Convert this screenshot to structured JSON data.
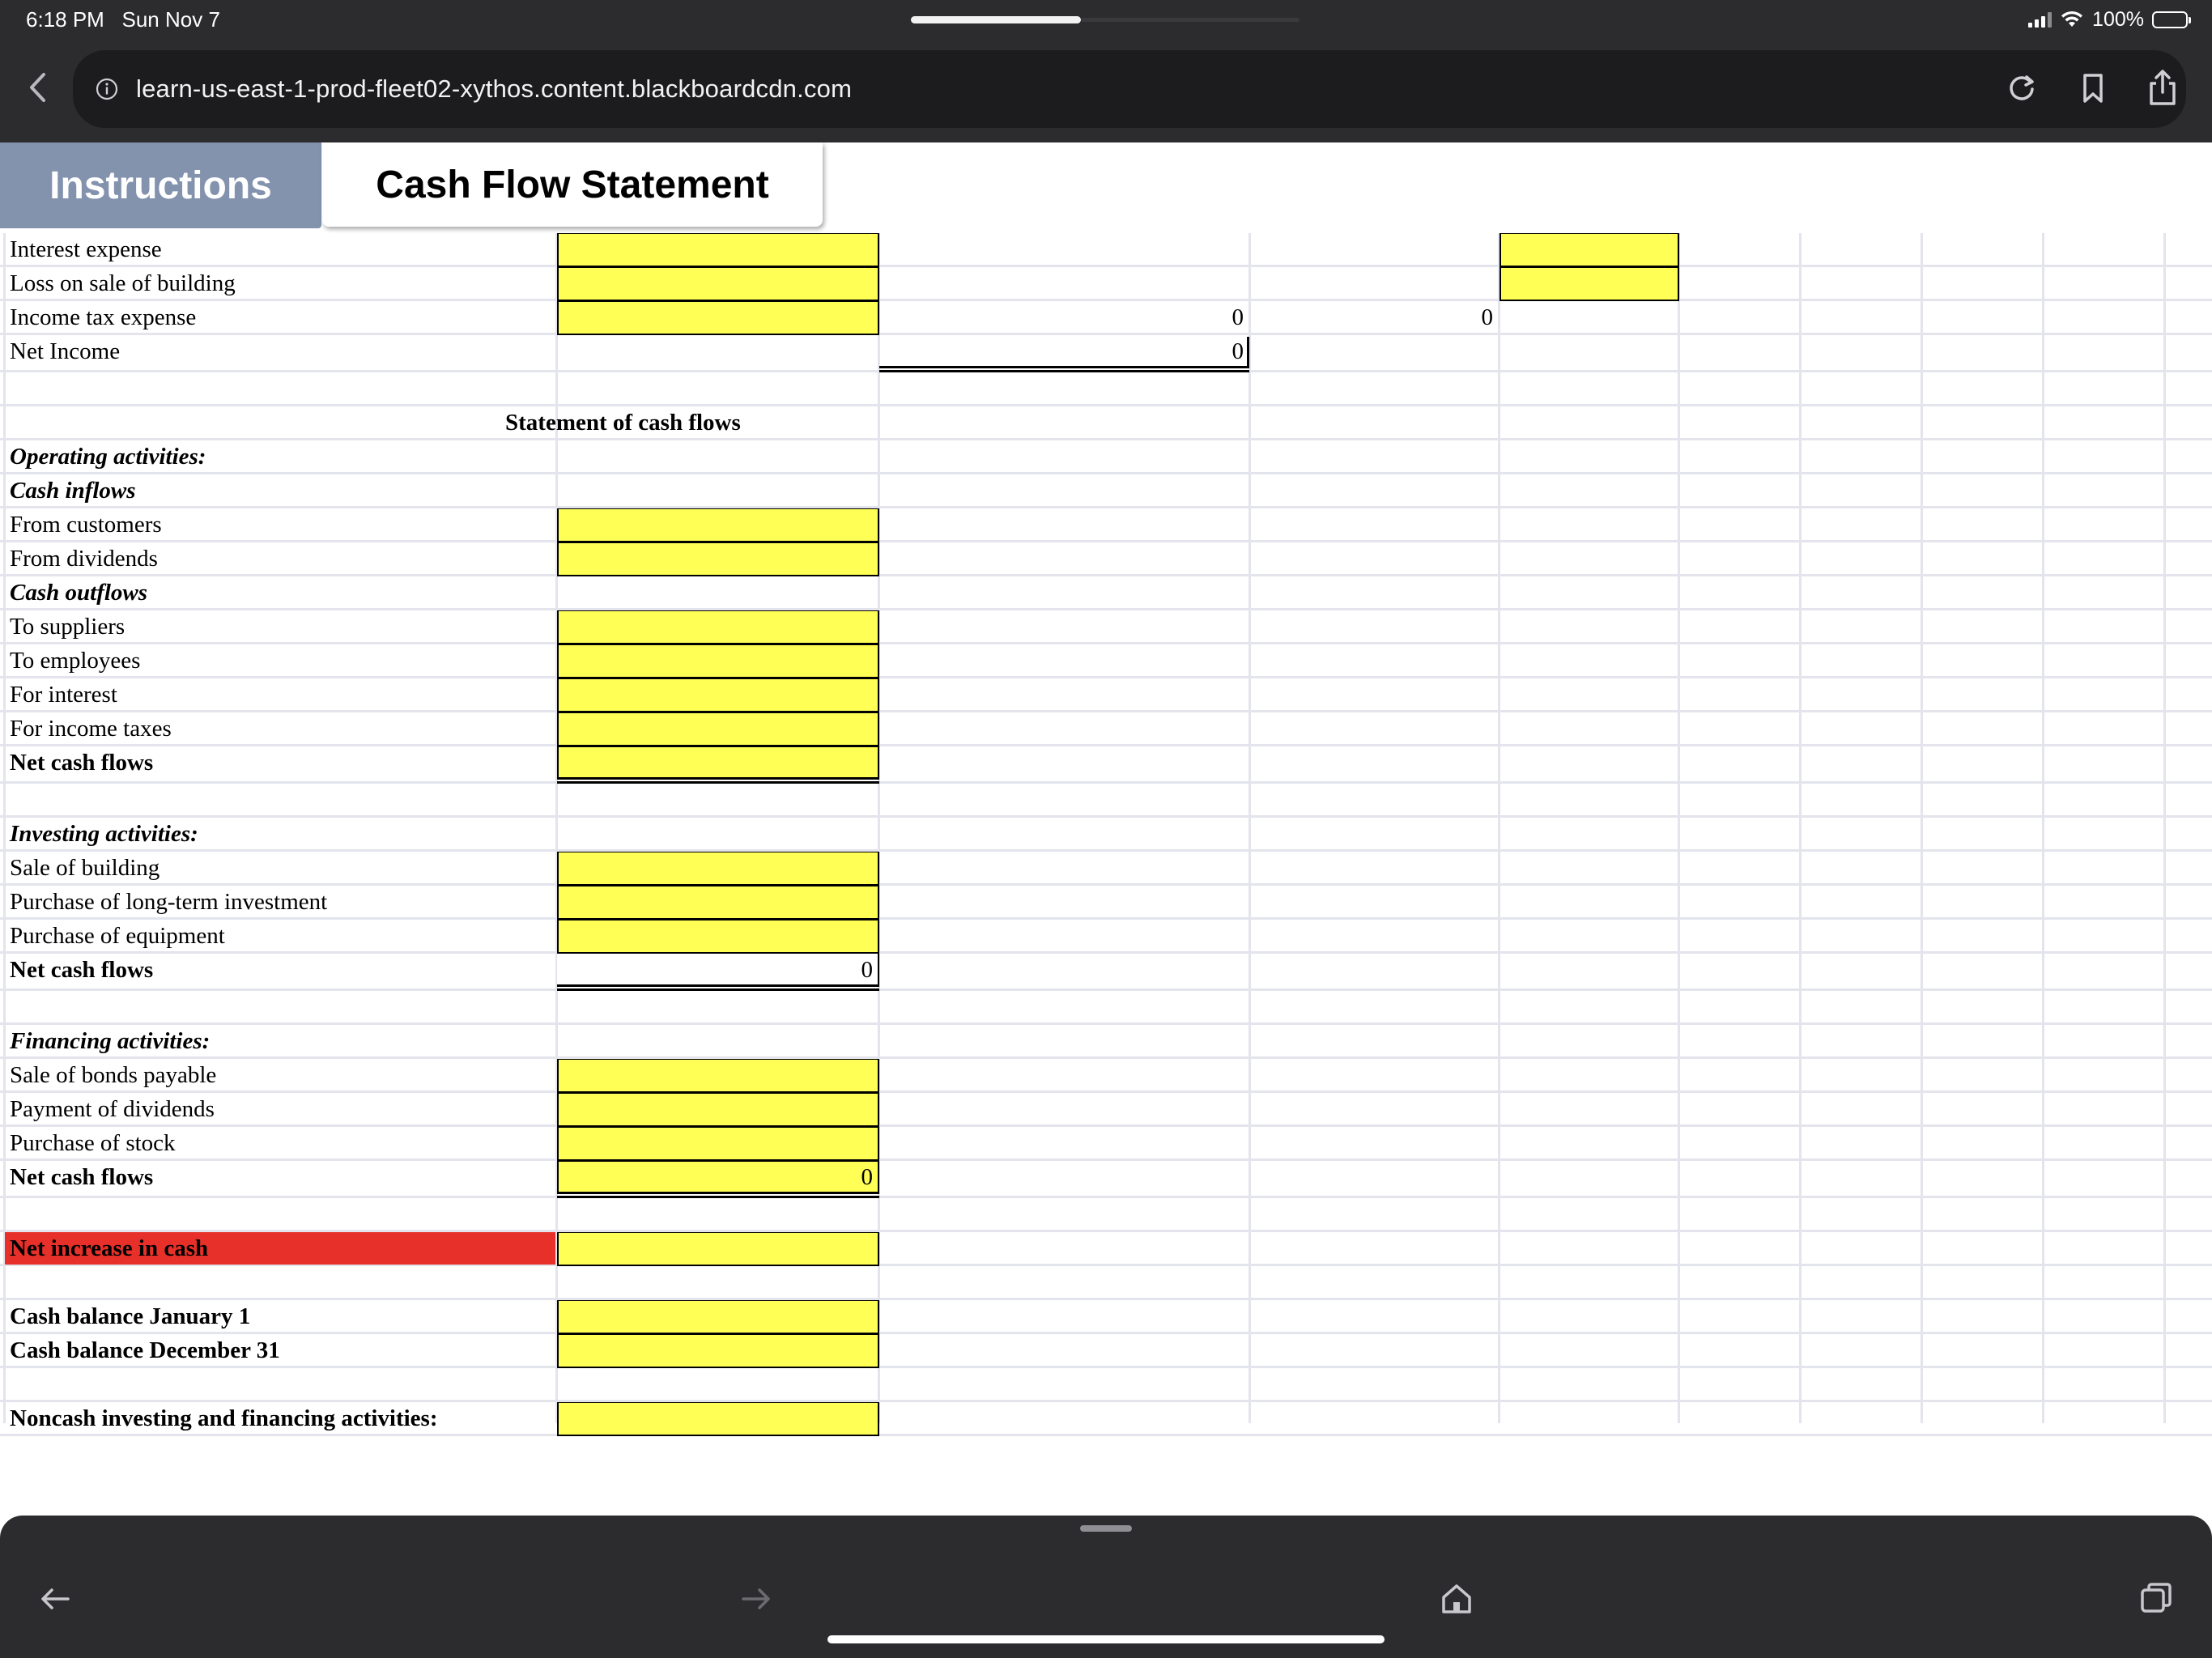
{
  "status_bar": {
    "time": "6:18 PM",
    "date": "Sun Nov 7",
    "battery": "100%"
  },
  "browser": {
    "url": "learn-us-east-1-prod-fleet02-xythos.content.blackboardcdn.com"
  },
  "tabs": [
    {
      "label": "Instructions",
      "active": false
    },
    {
      "label": "Cash Flow Statement",
      "active": true
    }
  ],
  "income_rows": [
    {
      "label": "Interest expense"
    },
    {
      "label": "Loss on sale of building"
    },
    {
      "label": "Income tax expense",
      "col_d": "0",
      "col_e": "0"
    },
    {
      "label": "Net Income",
      "col_d": "0"
    }
  ],
  "statement_title": "Statement of cash flows",
  "operating": {
    "heading": "Operating activities:",
    "inflows_heading": "Cash inflows",
    "inflows": [
      "From customers",
      "From dividends"
    ],
    "outflows_heading": "Cash outflows",
    "outflows": [
      "To suppliers",
      "To employees",
      "For interest",
      "For income taxes"
    ],
    "net_label": "Net cash flows"
  },
  "investing": {
    "heading": "Investing activities:",
    "items": [
      "Sale of building",
      "Purchase of long-term investment",
      "Purchase of equipment"
    ],
    "net_label": "Net cash flows",
    "net_value": "0"
  },
  "financing": {
    "heading": "Financing activities:",
    "items": [
      "Sale of bonds payable",
      "Payment of dividends",
      "Purchase of stock"
    ],
    "net_label": "Net cash flows",
    "net_value": "0"
  },
  "summary": {
    "net_increase_label": "Net increase in cash",
    "cash_jan_label": "Cash balance January 1",
    "cash_dec_label": "Cash balance December 31",
    "noncash_label": "Noncash investing and financing activities:"
  },
  "colors": {
    "input_yellow": "#ffff55",
    "highlight_red": "#e8302a",
    "chrome_dark": "#2c2c2e",
    "tab_inactive": "#8392ad"
  }
}
